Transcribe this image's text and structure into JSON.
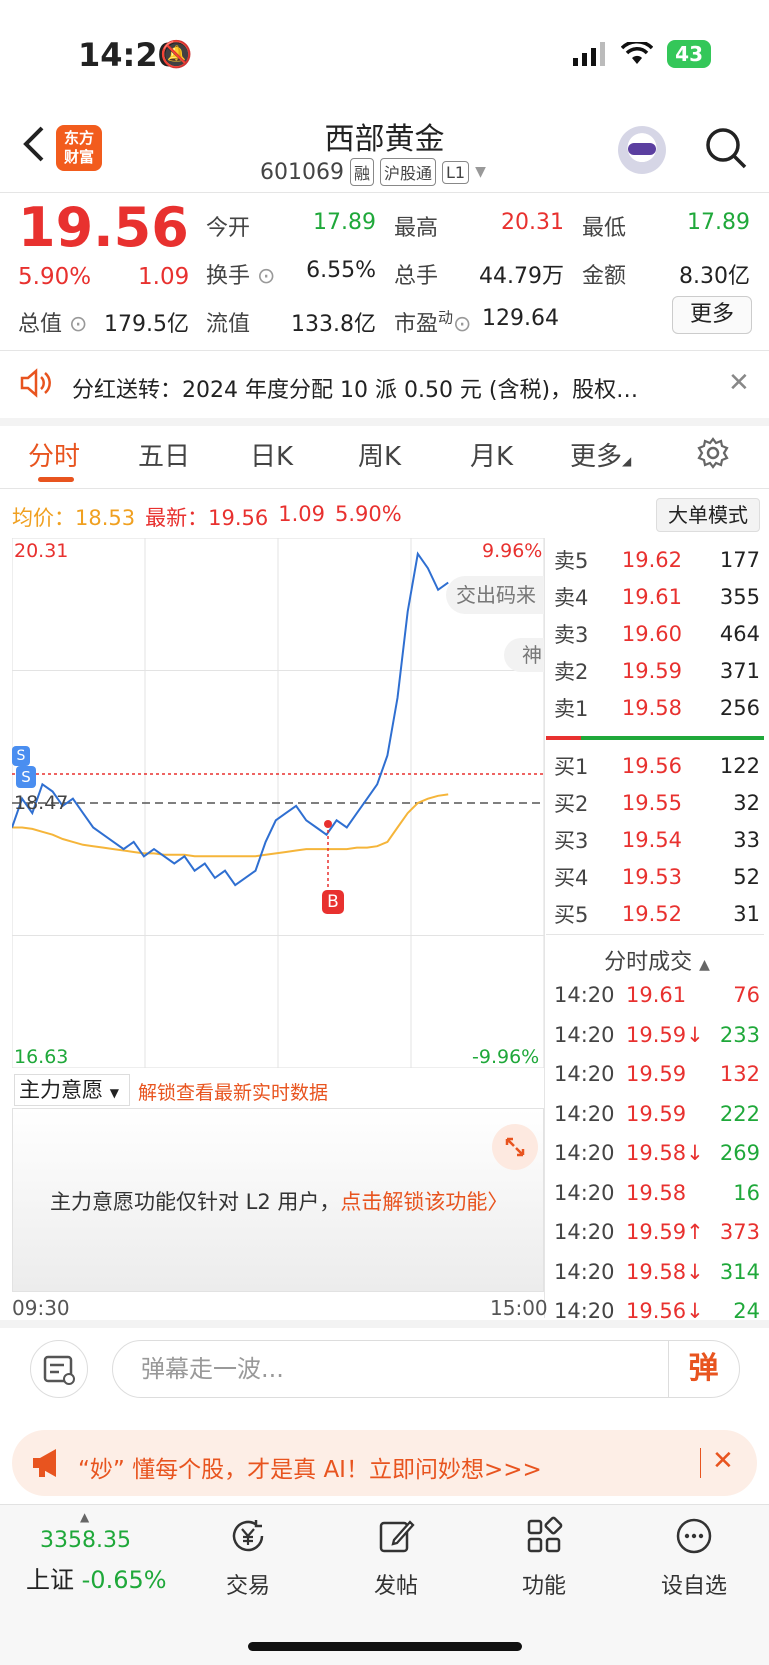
{
  "status": {
    "time": "14:20",
    "battery": "43"
  },
  "header": {
    "logo_line1": "东方",
    "logo_line2": "财富",
    "stock_name": "西部黄金",
    "stock_code": "601069",
    "tags": [
      "融",
      "沪股通",
      "L1"
    ]
  },
  "quote": {
    "price": "19.56",
    "pct": "5.90%",
    "change": "1.09",
    "total_value_label": "总值",
    "total_value": "179.5亿",
    "open_label": "今开",
    "open": "17.89",
    "high_label": "最高",
    "high": "20.31",
    "low_label": "最低",
    "low": "17.89",
    "turnover_label": "换手",
    "turnover": "6.55%",
    "volume_label": "总手",
    "volume": "44.79万",
    "amount_label": "金额",
    "amount": "8.30亿",
    "float_label": "流值",
    "float_value": "133.8亿",
    "pe_label": "市盈",
    "pe_sup": "动",
    "pe": "129.64",
    "more_label": "更多"
  },
  "notice": {
    "text": "分红送转：2024 年度分配 10 派 0.50 元 (含税)，股权…"
  },
  "tabs": [
    "分时",
    "五日",
    "日K",
    "周K",
    "月K",
    "更多"
  ],
  "chart_header": {
    "avg_label": "均价：",
    "avg": "18.53",
    "latest_label": "最新：",
    "latest": "19.56",
    "latest_chg": "1.09",
    "latest_pct": "5.90%",
    "big_order_label": "大单模式"
  },
  "chart_data": {
    "type": "line",
    "y_top": "20.31",
    "y_mid": "18.47",
    "y_bottom": "16.63",
    "pct_top": "9.96%",
    "pct_bottom": "-9.96%",
    "x_start": "09:30",
    "x_end": "15:00",
    "ylim": [
      16.63,
      20.31
    ],
    "marker_b": "B",
    "marker_s": "S",
    "bubble_1": "交出码来",
    "bubble_2": "神",
    "price_series": [
      18.3,
      18.5,
      18.4,
      18.6,
      18.55,
      18.45,
      18.5,
      18.4,
      18.3,
      18.25,
      18.2,
      18.15,
      18.2,
      18.1,
      18.15,
      18.1,
      18.05,
      18.1,
      18.0,
      18.05,
      17.95,
      18.0,
      17.9,
      17.95,
      18.0,
      18.2,
      18.35,
      18.4,
      18.45,
      18.35,
      18.3,
      18.25,
      18.35,
      18.3,
      18.4,
      18.5,
      18.6,
      18.8,
      19.2,
      19.8,
      20.2,
      20.1,
      19.95,
      20.0
    ],
    "avg_series": [
      18.3,
      18.3,
      18.29,
      18.27,
      18.25,
      18.22,
      18.2,
      18.18,
      18.17,
      18.16,
      18.15,
      18.14,
      18.13,
      18.12,
      18.12,
      18.11,
      18.11,
      18.11,
      18.1,
      18.1,
      18.1,
      18.1,
      18.1,
      18.1,
      18.1,
      18.11,
      18.12,
      18.13,
      18.14,
      18.15,
      18.15,
      18.15,
      18.15,
      18.15,
      18.16,
      18.16,
      18.17,
      18.2,
      18.3,
      18.4,
      18.47,
      18.5,
      18.52,
      18.53
    ]
  },
  "order_book": {
    "asks": [
      {
        "label": "卖5",
        "price": "19.62",
        "vol": "177"
      },
      {
        "label": "卖4",
        "price": "19.61",
        "vol": "355"
      },
      {
        "label": "卖3",
        "price": "19.60",
        "vol": "464"
      },
      {
        "label": "卖2",
        "price": "19.59",
        "vol": "371"
      },
      {
        "label": "卖1",
        "price": "19.58",
        "vol": "256"
      }
    ],
    "bids": [
      {
        "label": "买1",
        "price": "19.56",
        "vol": "122"
      },
      {
        "label": "买2",
        "price": "19.55",
        "vol": "32"
      },
      {
        "label": "买3",
        "price": "19.54",
        "vol": "33"
      },
      {
        "label": "买4",
        "price": "19.53",
        "vol": "52"
      },
      {
        "label": "买5",
        "price": "19.52",
        "vol": "31"
      }
    ]
  },
  "trades": {
    "title": "分时成交",
    "rows": [
      {
        "time": "14:20",
        "price": "19.61",
        "vol": "76",
        "color": "#e8312f"
      },
      {
        "time": "14:20",
        "price": "19.59↓",
        "vol": "233",
        "color": "#1fa83a"
      },
      {
        "time": "14:20",
        "price": "19.59",
        "vol": "132",
        "color": "#e8312f"
      },
      {
        "time": "14:20",
        "price": "19.59",
        "vol": "222",
        "color": "#1fa83a"
      },
      {
        "time": "14:20",
        "price": "19.58↓",
        "vol": "269",
        "color": "#1fa83a"
      },
      {
        "time": "14:20",
        "price": "19.58",
        "vol": "16",
        "color": "#1fa83a"
      },
      {
        "time": "14:20",
        "price": "19.59↑",
        "vol": "373",
        "color": "#e8312f"
      },
      {
        "time": "14:20",
        "price": "19.58↓",
        "vol": "314",
        "color": "#1fa83a"
      },
      {
        "time": "14:20",
        "price": "19.56↓",
        "vol": "24",
        "color": "#1fa83a"
      }
    ]
  },
  "indicator": {
    "select_label": "主力意愿",
    "unlock_text": "解锁查看最新实时数据",
    "msg": "主力意愿功能仅针对 L2 用户，",
    "msg_link": "点击解锁该功能〉"
  },
  "comment": {
    "placeholder": "弹幕走一波...",
    "danmu_label": "弹"
  },
  "ad": {
    "text": "“妙” 懂每个股，才是真 AI！立即问妙想>>>"
  },
  "nav": {
    "index_value": "3358.35",
    "index_name": "上证",
    "index_change": "-0.65%",
    "items": [
      "交易",
      "发帖",
      "功能",
      "设自选"
    ]
  }
}
